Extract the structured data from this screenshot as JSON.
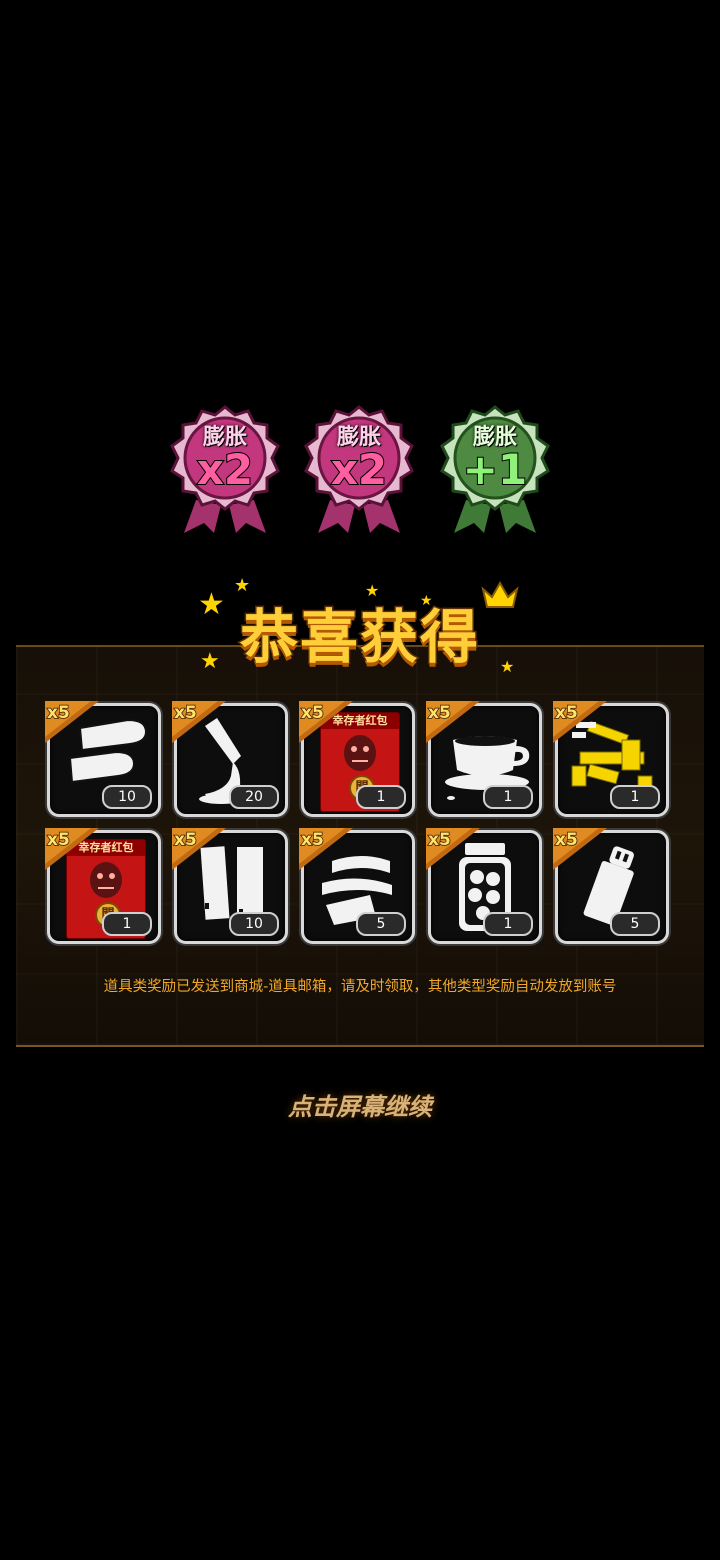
{
  "badges": [
    {
      "label": "膨胀",
      "value": "x2",
      "color": "#c2377e"
    },
    {
      "label": "膨胀",
      "value": "x2",
      "color": "#c2377e"
    },
    {
      "label": "膨胀",
      "value": "+1",
      "color": "#4e8a42"
    }
  ],
  "title": "恭喜获得",
  "rewards": [
    {
      "multiplier": "x5",
      "count": "10",
      "icon": "bullets-icon"
    },
    {
      "multiplier": "x5",
      "count": "20",
      "icon": "glue-tube-icon"
    },
    {
      "multiplier": "x5",
      "count": "1",
      "icon": "survivor-red-packet-icon",
      "label": "幸存者红包"
    },
    {
      "multiplier": "x5",
      "count": "1",
      "icon": "coffee-cup-icon"
    },
    {
      "multiplier": "x5",
      "count": "1",
      "icon": "gold-parts-icon"
    },
    {
      "multiplier": "x5",
      "count": "1",
      "icon": "survivor-red-packet-icon",
      "label": "幸存者红包"
    },
    {
      "multiplier": "x5",
      "count": "10",
      "icon": "battery-icon"
    },
    {
      "multiplier": "x5",
      "count": "5",
      "icon": "bandage-roll-icon"
    },
    {
      "multiplier": "x5",
      "count": "1",
      "icon": "pickle-jar-icon"
    },
    {
      "multiplier": "x5",
      "count": "5",
      "icon": "lighter-icon"
    }
  ],
  "red_packet_seal": "開",
  "notice": "道具类奖励已发送到商城-道具邮箱，请及时领取，其他类型奖励自动发放到账号",
  "continue_hint": "点击屏幕继续",
  "colors": {
    "gold": "#ffcf3a",
    "notice": "#f0a82a",
    "pink_badge": "#c2377e",
    "green_badge": "#4e8a42"
  }
}
